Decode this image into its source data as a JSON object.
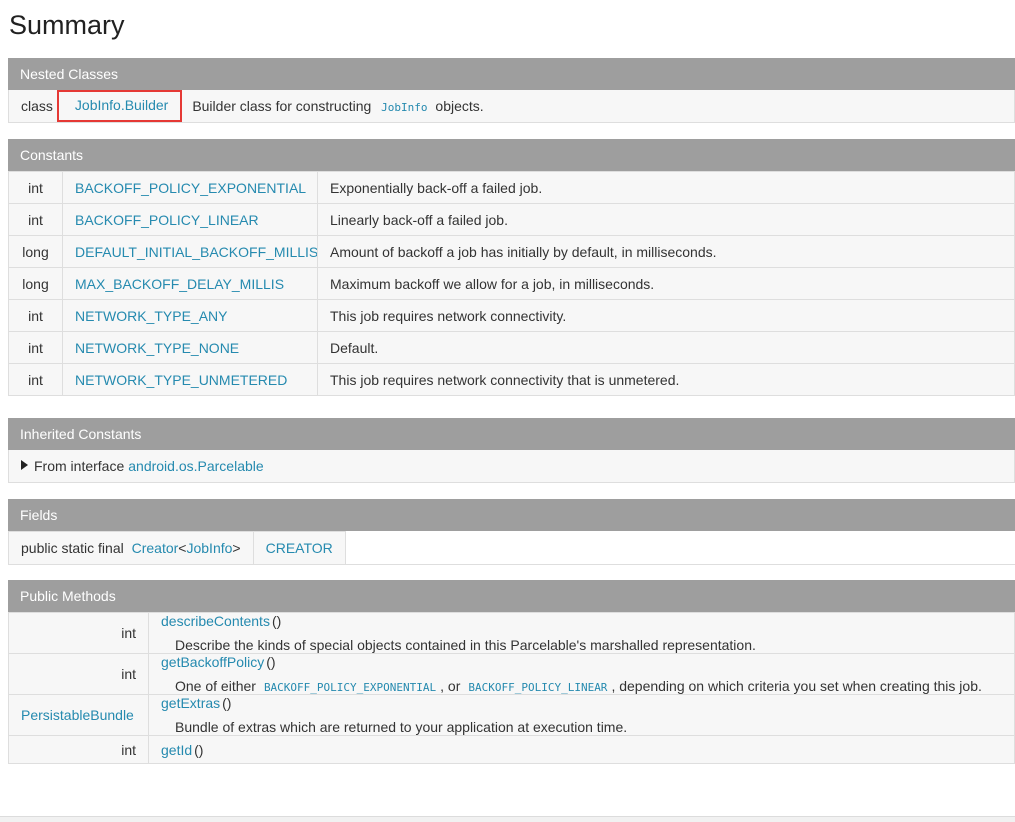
{
  "page_title": "Summary",
  "nested": {
    "header": "Nested Classes",
    "type": "class",
    "link": "JobInfo.Builder",
    "desc_pre": "Builder class for constructing",
    "desc_code": "JobInfo",
    "desc_post": "objects."
  },
  "constants": {
    "header": "Constants",
    "rows": [
      {
        "type": "int",
        "name": "BACKOFF_POLICY_EXPONENTIAL",
        "desc": "Exponentially back-off a failed job."
      },
      {
        "type": "int",
        "name": "BACKOFF_POLICY_LINEAR",
        "desc": "Linearly back-off a failed job."
      },
      {
        "type": "long",
        "name": "DEFAULT_INITIAL_BACKOFF_MILLIS",
        "desc": "Amount of backoff a job has initially by default, in milliseconds."
      },
      {
        "type": "long",
        "name": "MAX_BACKOFF_DELAY_MILLIS",
        "desc": "Maximum backoff we allow for a job, in milliseconds."
      },
      {
        "type": "int",
        "name": "NETWORK_TYPE_ANY",
        "desc": "This job requires network connectivity."
      },
      {
        "type": "int",
        "name": "NETWORK_TYPE_NONE",
        "desc": "Default."
      },
      {
        "type": "int",
        "name": "NETWORK_TYPE_UNMETERED",
        "desc": "This job requires network connectivity that is unmetered."
      }
    ]
  },
  "inherited": {
    "header": "Inherited Constants",
    "prefix": "From interface",
    "link": "android.os.Parcelable"
  },
  "fields": {
    "header": "Fields",
    "modifier": "public static final",
    "type_link": "Creator",
    "lt": "<",
    "generic_link": "JobInfo",
    "gt": ">",
    "name": "CREATOR"
  },
  "methods": {
    "header": "Public Methods",
    "rows": [
      {
        "ret": "int",
        "ret_is_link": false,
        "name": "describeContents",
        "parens": "()",
        "desc": "Describe the kinds of special objects contained in this Parcelable's marshalled representation."
      },
      {
        "ret": "int",
        "ret_is_link": false,
        "name": "getBackoffPolicy",
        "parens": "()",
        "desc_pre": "One of either",
        "desc_code1": "BACKOFF_POLICY_EXPONENTIAL",
        "desc_mid": ", or",
        "desc_code2": "BACKOFF_POLICY_LINEAR",
        "desc_post": ", depending on which criteria you set when creating this job."
      },
      {
        "ret": "PersistableBundle",
        "ret_is_link": true,
        "name": "getExtras",
        "parens": "()",
        "desc": "Bundle of extras which are returned to your application at execution time."
      },
      {
        "ret": "int",
        "ret_is_link": false,
        "name": "getId",
        "parens": "()"
      }
    ]
  }
}
